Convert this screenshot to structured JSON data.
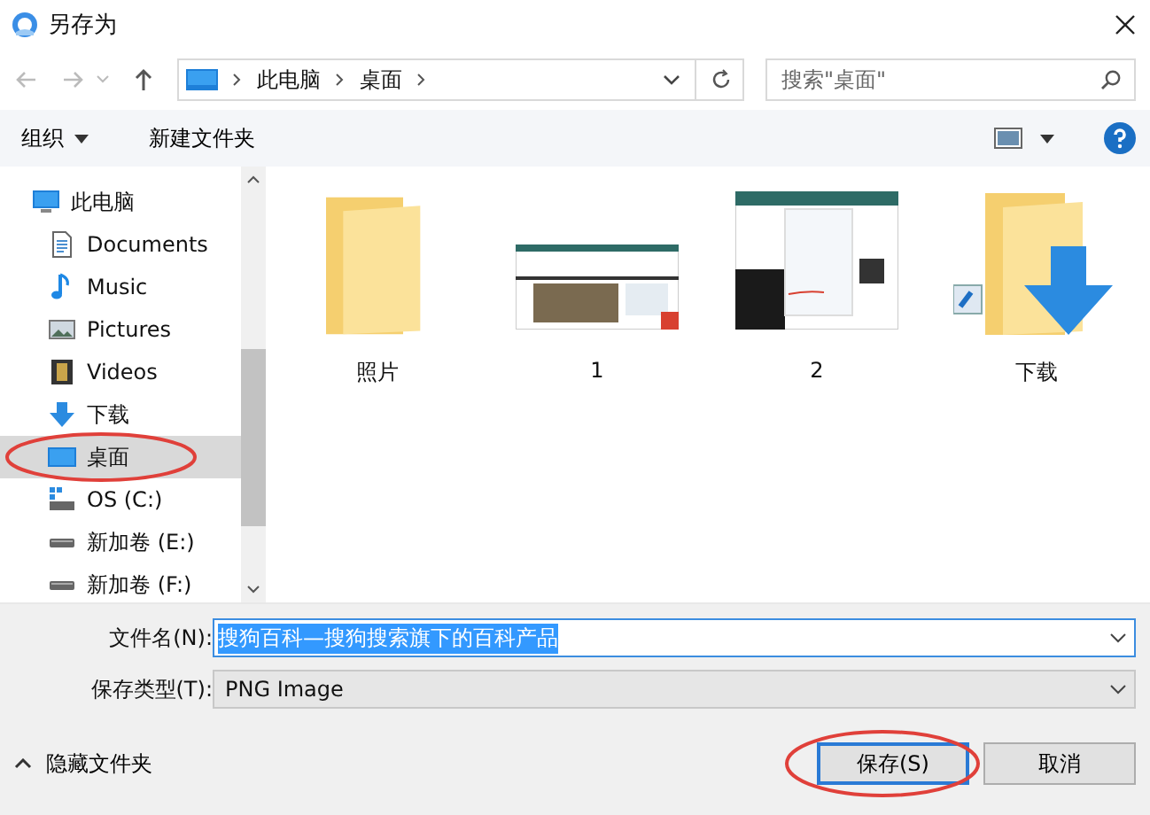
{
  "window": {
    "title": "另存为"
  },
  "address": {
    "crumbs": [
      "此电脑",
      "桌面"
    ]
  },
  "search": {
    "placeholder": "搜索\"桌面\""
  },
  "toolbar": {
    "organize": "组织",
    "new_folder": "新建文件夹"
  },
  "sidebar": {
    "items": [
      {
        "label": "此电脑",
        "kind": "computer",
        "selected": false,
        "children": [
          {
            "label": "Documents",
            "kind": "document",
            "selected": false
          },
          {
            "label": "Music",
            "kind": "music",
            "selected": false
          },
          {
            "label": "Pictures",
            "kind": "picture",
            "selected": false
          },
          {
            "label": "Videos",
            "kind": "video",
            "selected": false
          },
          {
            "label": "下载",
            "kind": "download",
            "selected": false
          },
          {
            "label": "桌面",
            "kind": "desktop",
            "selected": true
          },
          {
            "label": "OS (C:)",
            "kind": "system-drive",
            "selected": false
          },
          {
            "label": "新加卷 (E:)",
            "kind": "drive",
            "selected": false
          },
          {
            "label": "新加卷 (F:)",
            "kind": "drive",
            "selected": false
          }
        ]
      }
    ]
  },
  "files": [
    {
      "name": "照片",
      "kind": "folder"
    },
    {
      "name": "1",
      "kind": "screenshot-wide"
    },
    {
      "name": "2",
      "kind": "screenshot-tall"
    },
    {
      "name": "下载",
      "kind": "download-folder"
    }
  ],
  "filename": {
    "label": "文件名(N):",
    "value": "搜狗百科—搜狗搜索旗下的百科产品"
  },
  "filetype": {
    "label": "保存类型(T):",
    "value": "PNG Image"
  },
  "hide_folders": "隐藏文件夹",
  "buttons": [
    {
      "label": "保存(S)",
      "primary": true
    },
    {
      "label": "取消",
      "primary": false
    }
  ]
}
